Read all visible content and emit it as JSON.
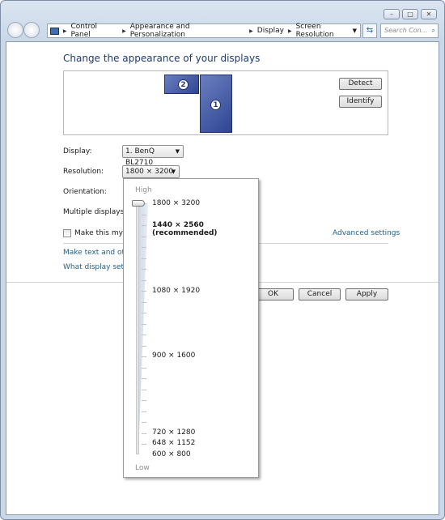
{
  "window": {
    "minimize": "minimize",
    "maximize": "maximize",
    "close": "close"
  },
  "address": {
    "crumbs": [
      "Control Panel",
      "Appearance and Personalization",
      "Display",
      "Screen Resolution"
    ],
    "search_placeholder": "Search Con..."
  },
  "page": {
    "title": "Change the appearance of your displays",
    "monitors": [
      {
        "number": "1"
      },
      {
        "number": "2"
      }
    ],
    "detect": "Detect",
    "identify": "Identify",
    "display_label": "Display:",
    "display_value": "1. BenQ BL2710",
    "resolution_label": "Resolution:",
    "resolution_value": "1800 × 3200",
    "orientation_label": "Orientation:",
    "multiple_label": "Multiple displays:",
    "main_checkbox": "Make this my main display",
    "main_checked": false,
    "advanced": "Advanced settings",
    "link1": "Make text and other items larger or smaller",
    "link2": "What display settings should I choose?",
    "ok": "OK",
    "cancel": "Cancel",
    "apply": "Apply"
  },
  "resolution_popup": {
    "high": "High",
    "low": "Low",
    "selected": "1800 × 3200",
    "options": [
      {
        "label": "1800 × 3200",
        "bold": false
      },
      {
        "label": "1440 × 2560 (recommended)",
        "bold": true
      },
      {
        "label": "1080 × 1920",
        "bold": false
      },
      {
        "label": "900 × 1600",
        "bold": false
      },
      {
        "label": "720 × 1280",
        "bold": false
      },
      {
        "label": "648 × 1152",
        "bold": false
      },
      {
        "label": "600 × 800",
        "bold": false
      }
    ]
  },
  "colors": {
    "link": "#1f5f8f",
    "title": "#1e3a6e",
    "monitor": "#3a50a0"
  }
}
